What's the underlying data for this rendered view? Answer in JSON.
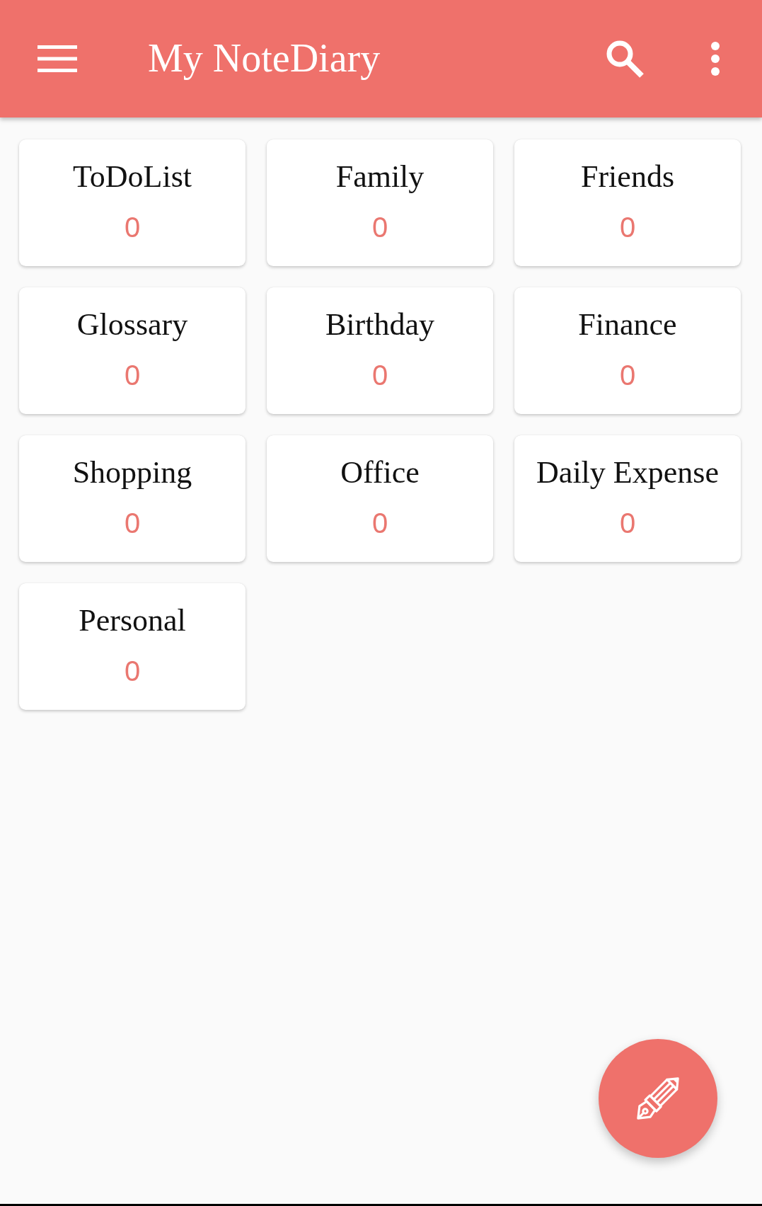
{
  "app_bar": {
    "title": "My NoteDiary"
  },
  "categories": [
    {
      "name": "ToDoList",
      "count": "0"
    },
    {
      "name": "Family",
      "count": "0"
    },
    {
      "name": "Friends",
      "count": "0"
    },
    {
      "name": "Glossary",
      "count": "0"
    },
    {
      "name": "Birthday",
      "count": "0"
    },
    {
      "name": "Finance",
      "count": "0"
    },
    {
      "name": "Shopping",
      "count": "0"
    },
    {
      "name": "Office",
      "count": "0"
    },
    {
      "name": "Daily Expense",
      "count": "0"
    },
    {
      "name": "Personal",
      "count": "0"
    }
  ]
}
